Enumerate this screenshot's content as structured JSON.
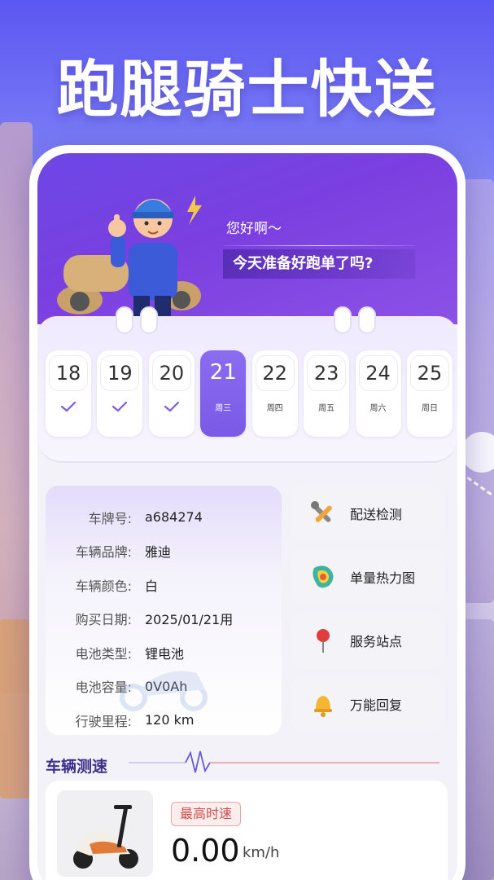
{
  "headline": "跑腿骑士快送",
  "banner": {
    "greeting": "您好啊～",
    "question": "今天准备好跑单了吗?"
  },
  "calendar": {
    "days": [
      {
        "num": "18",
        "week": "",
        "status": "checked"
      },
      {
        "num": "19",
        "week": "",
        "status": "checked"
      },
      {
        "num": "20",
        "week": "",
        "status": "checked"
      },
      {
        "num": "21",
        "week": "周三",
        "status": "active"
      },
      {
        "num": "22",
        "week": "周四",
        "status": "upcoming"
      },
      {
        "num": "23",
        "week": "周五",
        "status": "upcoming"
      },
      {
        "num": "24",
        "week": "周六",
        "status": "upcoming"
      },
      {
        "num": "25",
        "week": "周日",
        "status": "upcoming"
      }
    ]
  },
  "vehicle": {
    "rows": [
      {
        "key": "车牌号:",
        "value": "a684274"
      },
      {
        "key": "车辆品牌:",
        "value": "雅迪"
      },
      {
        "key": "车辆颜色:",
        "value": "白"
      },
      {
        "key": "购买日期:",
        "value": "2025/01/21用"
      },
      {
        "key": "电池类型:",
        "value": "锂电池"
      },
      {
        "key": "电池容量:",
        "value": "0V0Ah"
      },
      {
        "key": "行驶里程:",
        "value": "120 km"
      }
    ]
  },
  "tools": [
    {
      "label": "配送检测",
      "icon": "wrench-icon"
    },
    {
      "label": "单量热力图",
      "icon": "heatmap-icon"
    },
    {
      "label": "服务站点",
      "icon": "pin-icon"
    },
    {
      "label": "万能回复",
      "icon": "bell-icon"
    }
  ],
  "speed": {
    "title": "车辆测速",
    "badge": "最高时速",
    "value": "0.00",
    "unit": "km/h"
  },
  "colors": {
    "accent": "#7b5ae6",
    "banner": "#7b3fe0",
    "badge_text": "#d14a4a"
  }
}
